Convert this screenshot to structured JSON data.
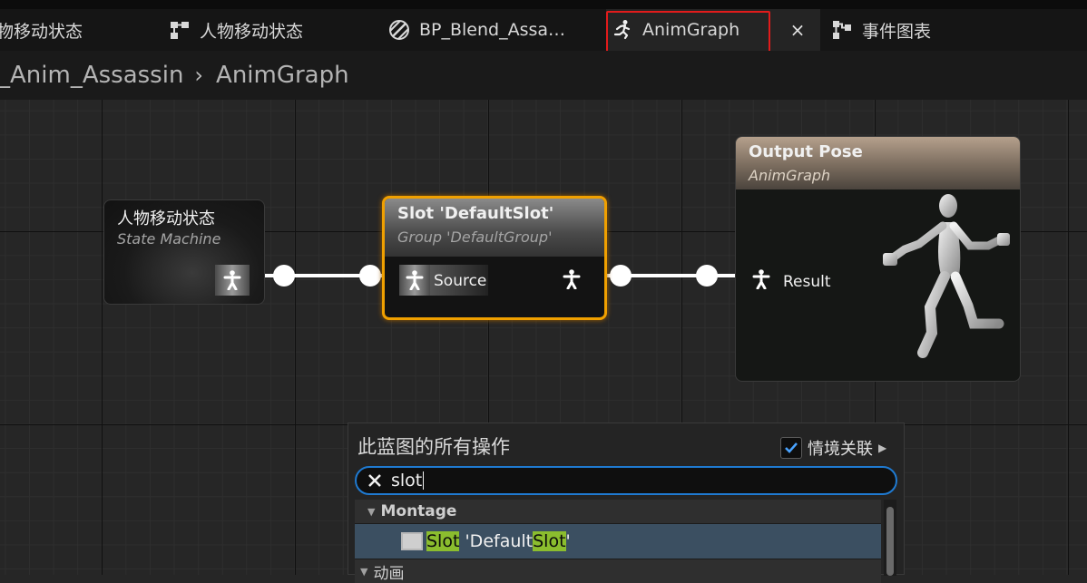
{
  "tabs": [
    {
      "label": "物移动状态",
      "icon": "state-machine-icon"
    },
    {
      "label": "人物移动状态",
      "icon": "state-machine-icon"
    },
    {
      "label": "BP_Blend_Assa…",
      "icon": "blendspace-icon"
    },
    {
      "label": "AnimGraph",
      "icon": "running-man-icon"
    },
    {
      "label": "事件图表",
      "icon": "event-graph-icon"
    }
  ],
  "close_symbol": "×",
  "breadcrumb": {
    "parent": "_Anim_Assassin",
    "separator": "›",
    "current": "AnimGraph"
  },
  "nodes": {
    "state_machine": {
      "title": "人物移动状态",
      "subtitle": "State Machine"
    },
    "slot": {
      "title": "Slot 'DefaultSlot'",
      "subtitle": "Group 'DefaultGroup'",
      "input_label": "Source"
    },
    "output": {
      "title": "Output Pose",
      "subtitle": "AnimGraph",
      "input_label": "Result"
    }
  },
  "action_menu": {
    "title": "此蓝图的所有操作",
    "context_label": "情境关联",
    "context_checked": true,
    "search_value": "slot",
    "categories": [
      {
        "label": "Montage",
        "expanded": true
      },
      {
        "label": "动画",
        "expanded": true
      }
    ],
    "selected_item": {
      "prefix": "Slot",
      "middle": " 'Default",
      "match": "Slot",
      "suffix": "'"
    }
  },
  "colors": {
    "highlight_border": "#e21b1b",
    "selected_node_border": "#f0a000",
    "search_border": "#1f7ad1",
    "match_highlight": "#8bbd2e"
  }
}
